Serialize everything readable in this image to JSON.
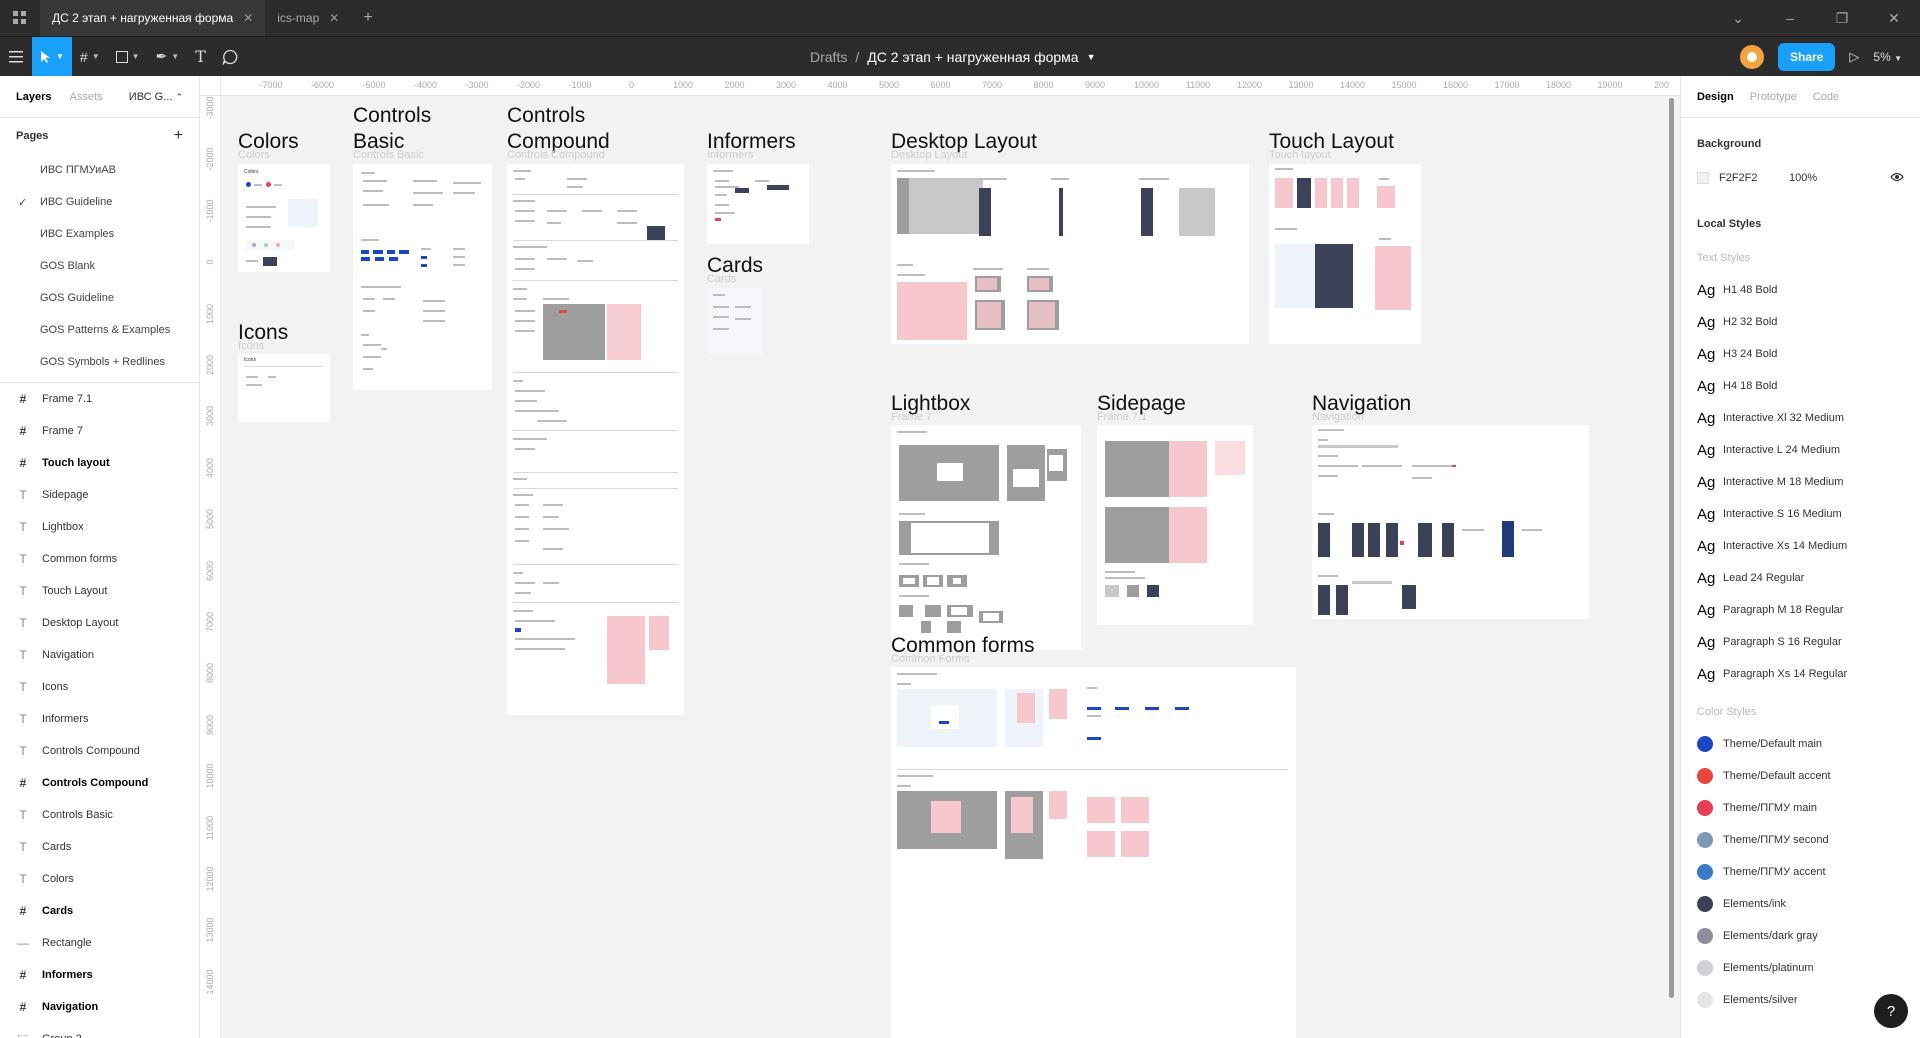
{
  "titlebar": {
    "tabs": [
      {
        "label": "ДС 2 этап + нагруженная форма",
        "active": true
      },
      {
        "label": "ics-map",
        "active": false
      }
    ]
  },
  "toolbar": {
    "breadcrumb_parent": "Drafts",
    "breadcrumb_sep": "/",
    "file_name": "ДС 2 этап + нагруженная форма",
    "share_label": "Share",
    "zoom": "5%"
  },
  "left_panel": {
    "tabs": {
      "layers": "Layers",
      "assets": "Assets",
      "page": "ИВС G..."
    },
    "pages_title": "Pages",
    "pages": [
      {
        "label": "ИВС ПГМУиАВ",
        "checked": false
      },
      {
        "label": "ИВС Guideline",
        "checked": true
      },
      {
        "label": "ИВС Examples",
        "checked": false
      },
      {
        "label": "GOS Blank",
        "checked": false
      },
      {
        "label": "GOS Guideline",
        "checked": false
      },
      {
        "label": "GOS Patterns & Examples",
        "checked": false
      },
      {
        "label": "GOS Symbols + Redlines",
        "checked": false
      }
    ],
    "layers": [
      {
        "label": "Frame 7.1",
        "type": "frame",
        "bold": false
      },
      {
        "label": "Frame 7",
        "type": "frame",
        "bold": false
      },
      {
        "label": "Touch layout",
        "type": "frame",
        "bold": true
      },
      {
        "label": "Sidepage",
        "type": "text",
        "bold": false
      },
      {
        "label": "Lightbox",
        "type": "text",
        "bold": false
      },
      {
        "label": "Common forms",
        "type": "text",
        "bold": false
      },
      {
        "label": "Touch Layout",
        "type": "text",
        "bold": false
      },
      {
        "label": "Desktop Layout",
        "type": "text",
        "bold": false
      },
      {
        "label": "Navigation",
        "type": "text",
        "bold": false
      },
      {
        "label": "Icons",
        "type": "text",
        "bold": false
      },
      {
        "label": "Informers",
        "type": "text",
        "bold": false
      },
      {
        "label": "Controls Compound",
        "type": "text",
        "bold": false
      },
      {
        "label": "Controls Compound",
        "type": "frame",
        "bold": true
      },
      {
        "label": "Controls Basic",
        "type": "text",
        "bold": false
      },
      {
        "label": "Cards",
        "type": "text",
        "bold": false
      },
      {
        "label": "Colors",
        "type": "text",
        "bold": false
      },
      {
        "label": "Cards",
        "type": "frame",
        "bold": true
      },
      {
        "label": "Rectangle",
        "type": "rect",
        "bold": false
      },
      {
        "label": "Informers",
        "type": "frame",
        "bold": true
      },
      {
        "label": "Navigation",
        "type": "frame",
        "bold": true
      },
      {
        "label": "Group 2",
        "type": "group",
        "bold": false
      }
    ]
  },
  "canvas": {
    "ruler_x": [
      "-7000",
      "-6000",
      "-5000",
      "-4000",
      "-3000",
      "-2000",
      "-1000",
      "0",
      "1000",
      "2000",
      "3000",
      "4000",
      "5000",
      "6000",
      "7000",
      "8000",
      "9000",
      "10000",
      "11000",
      "12000",
      "13000",
      "14000",
      "15000",
      "16000",
      "17000",
      "18000",
      "19000",
      "200"
    ],
    "ruler_y": [
      "-3000",
      "-2000",
      "-1000",
      "0",
      "1000",
      "2000",
      "3000",
      "4000",
      "5000",
      "6000",
      "7000",
      "8000",
      "9000",
      "10000",
      "11000",
      "12000",
      "13000",
      "14000"
    ],
    "frames": {
      "colors": {
        "title": "Colors",
        "sub": "Colors",
        "inner": "Colors"
      },
      "icons": {
        "title": "Icons",
        "sub": "Icons",
        "inner": "Icons"
      },
      "controls_basic": {
        "title_1": "Controls",
        "title_2": "Basic",
        "sub": "Controls Basic"
      },
      "controls_compound": {
        "title_1": "Controls",
        "title_2": "Compound",
        "sub": "Controls Compound"
      },
      "informers": {
        "title": "Informers",
        "sub": "Informers"
      },
      "cards": {
        "title": "Cards",
        "sub": "Cards"
      },
      "desktop": {
        "title": "Desktop Layout",
        "sub": "Desktop Layout"
      },
      "touch": {
        "title": "Touch Layout",
        "sub": "Touch layout"
      },
      "lightbox": {
        "title": "Lightbox",
        "sub": "Frame 7"
      },
      "sidepage": {
        "title": "Sidepage",
        "sub": "Frame 7.1"
      },
      "navigation": {
        "title": "Navigation",
        "sub": "Navigation"
      },
      "common_forms": {
        "title": "Common forms",
        "sub": "Common Forms"
      }
    }
  },
  "right_panel": {
    "tabs": {
      "design": "Design",
      "prototype": "Prototype",
      "code": "Code"
    },
    "background_title": "Background",
    "background_hex": "F2F2F2",
    "background_opacity": "100%",
    "local_styles_title": "Local Styles",
    "text_styles_title": "Text Styles",
    "text_styles": [
      "H1 48 Bold",
      "H2 32 Bold",
      "H3 24 Bold",
      "H4 18 Bold",
      "Interactive Xl 32 Medium",
      "Interactive L 24 Medium",
      "Interactive M 18 Medium",
      "Interactive S 16 Medium",
      "Interactive Xs 14 Medium",
      "Lead 24 Regular",
      "Paragraph M 18 Regular",
      "Paragraph S 16 Regular",
      "Paragraph Xs 14 Regular"
    ],
    "ag_glyph": "Ag",
    "color_styles_title": "Color Styles",
    "color_styles": [
      {
        "label": "Theme/Default main",
        "color": "#1b47c7"
      },
      {
        "label": "Theme/Default accent",
        "color": "#e8473b"
      },
      {
        "label": "Theme/ПГМУ main",
        "color": "#e63e55"
      },
      {
        "label": "Theme/ПГМУ second",
        "color": "#7f9ab4"
      },
      {
        "label": "Theme/ПГМУ accent",
        "color": "#3a7bc8"
      },
      {
        "label": "Elements/ink",
        "color": "#3b4156"
      },
      {
        "label": "Elements/dark gray",
        "color": "#8a8f99"
      },
      {
        "label": "Elements/platinum",
        "color": "#cfd1d4"
      },
      {
        "label": "Elements/silver",
        "color": "#e2e4e6"
      }
    ],
    "help": "?"
  }
}
